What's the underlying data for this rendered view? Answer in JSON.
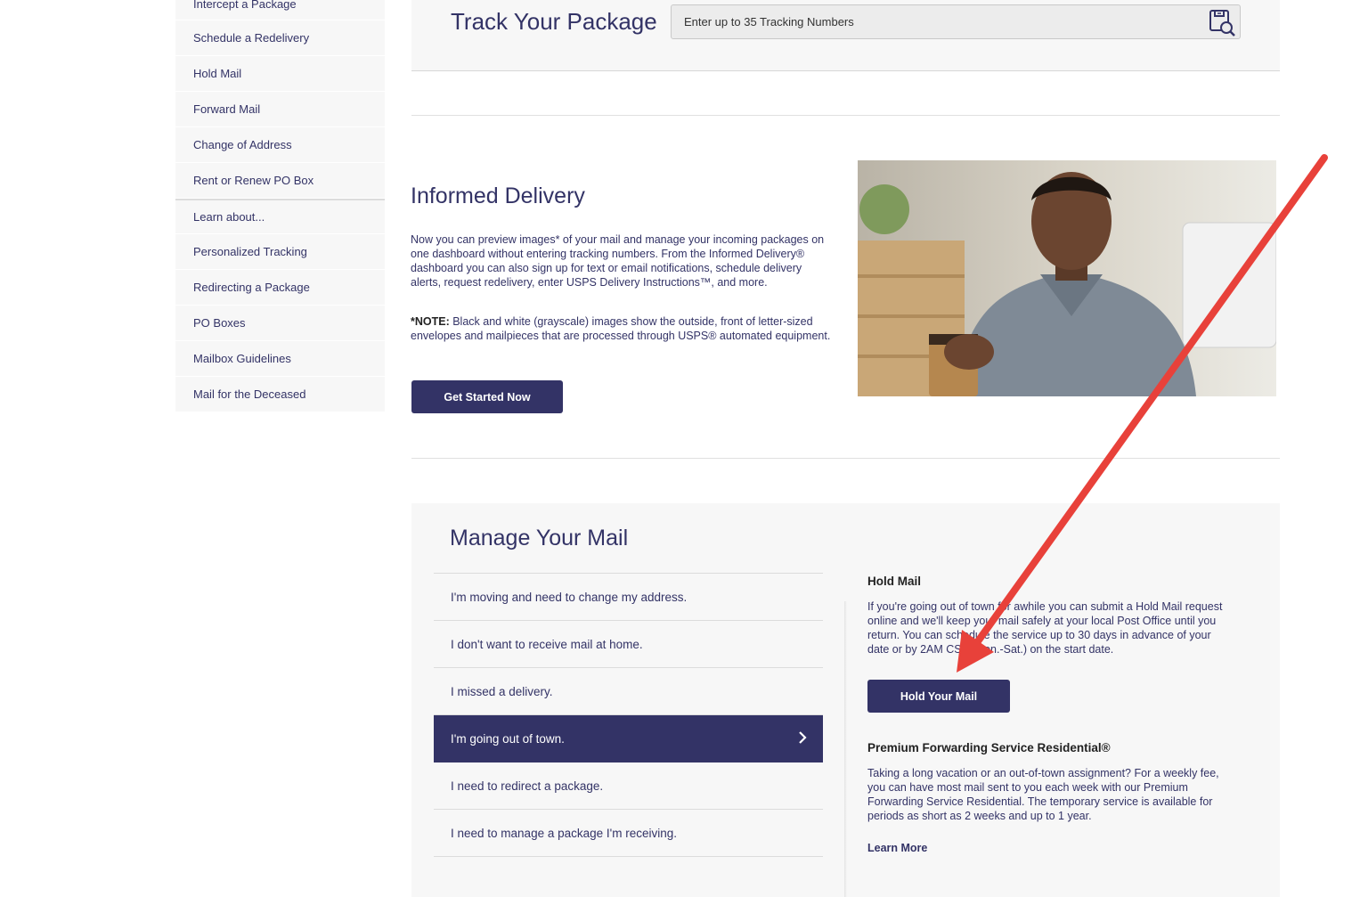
{
  "sidebar": {
    "items": [
      {
        "label": "Intercept a Package"
      },
      {
        "label": "Schedule a Redelivery"
      },
      {
        "label": "Hold Mail"
      },
      {
        "label": "Forward Mail"
      },
      {
        "label": "Change of Address"
      },
      {
        "label": "Rent or Renew PO Box"
      },
      {
        "label": "Learn about..."
      },
      {
        "label": "Personalized Tracking"
      },
      {
        "label": "Redirecting a Package"
      },
      {
        "label": "PO Boxes"
      },
      {
        "label": "Mailbox Guidelines"
      },
      {
        "label": "Mail for the Deceased"
      }
    ]
  },
  "track": {
    "title": "Track Your Package",
    "placeholder": "Enter up to 35 Tracking Numbers"
  },
  "informed": {
    "title": "Informed Delivery",
    "body": "Now you can preview images* of your mail and manage your incoming packages on one dashboard without entering tracking numbers. From the Informed Delivery® dashboard you can also sign up for text or email notifications, schedule delivery alerts, request redelivery, enter USPS Delivery Instructions™, and more.",
    "note_label": "*NOTE:",
    "note_text": " Black and white (grayscale) images show the outside, front of letter-sized envelopes and mailpieces that are processed through USPS® automated equipment.",
    "button": "Get Started Now"
  },
  "manage": {
    "title": "Manage Your Mail",
    "options": [
      {
        "label": "I'm moving and need to change my address.",
        "active": false
      },
      {
        "label": "I don't want to receive mail at home.",
        "active": false
      },
      {
        "label": "I missed a delivery.",
        "active": false
      },
      {
        "label": "I'm going out of town.",
        "active": true
      },
      {
        "label": "I need to redirect a package.",
        "active": false
      },
      {
        "label": "I need to manage a package I'm receiving.",
        "active": false
      }
    ],
    "hold_title": "Hold Mail",
    "hold_body": "If you're going out of town for awhile you can submit a Hold Mail request online and we'll keep your mail safely at your local Post Office until you return. You can schedule the service up to 30 days in advance of your date or by 2AM CST (Mon.-Sat.) on the start date.",
    "hold_button": "Hold Your Mail",
    "pf_title": "Premium Forwarding Service Residential®",
    "pf_body": "Taking a long vacation or an out-of-town assignment? For a weekly fee, you can have most mail sent to you each week with our Premium Forwarding Service Residential. The temporary service is available for periods as short as 2 weeks and up to 1 year.",
    "learn_more": "Learn More"
  },
  "colors": {
    "brand": "#333366",
    "annotation_arrow": "#e8413a"
  }
}
